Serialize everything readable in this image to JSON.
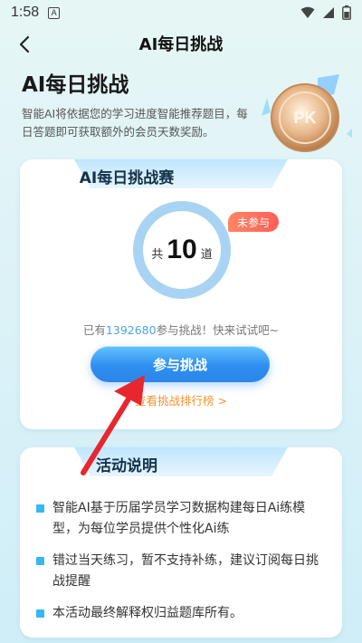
{
  "status_bar": {
    "time": "1:58",
    "notification_letter": "A"
  },
  "nav": {
    "title": "AI每日挑战"
  },
  "hero": {
    "title": "AI每日挑战",
    "description": "智能AI将依据您的学习进度智能推荐题目，每日答题即可获取额外的会员天数奖励。",
    "medal_label": "PK"
  },
  "challenge": {
    "tab_title": "AI每日挑战赛",
    "status_badge": "未参与",
    "count_prefix": "共",
    "count": "10",
    "count_suffix": "道",
    "participants_prefix": "已有",
    "participants_count": "1392680",
    "participants_suffix": "参与挑战！快来试试吧~",
    "join_button": "参与挑战",
    "rank_link": "查看挑战排行榜 >"
  },
  "activity": {
    "tab_title": "活动说明",
    "rules": [
      "智能AI基于历届学员学习数据构建每日Ai练模型，为每位学员提供个性化Ai练",
      "错过当天练习，暂不支持补练，建议订阅每日挑战提醒",
      "本活动最终解释权归益题库所有。"
    ]
  },
  "colors": {
    "accent_blue": "#2f8ff1",
    "badge_red": "#ff5f58",
    "link_orange": "#f5932f",
    "number_blue": "#4da3e6",
    "annotation_arrow": "#e8262e"
  }
}
